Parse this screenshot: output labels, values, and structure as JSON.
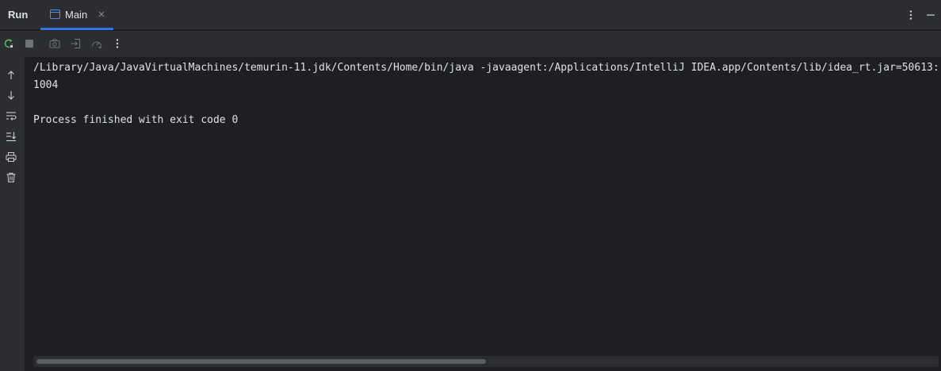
{
  "header": {
    "title": "Run",
    "tab": {
      "label": "Main"
    }
  },
  "icons": {
    "header": [
      "window-icon",
      "close-icon",
      "more-vertical-icon",
      "minimize-icon"
    ],
    "toolbar": [
      "rerun-icon",
      "stop-icon",
      "camera-icon",
      "exit-icon",
      "gauge-icon",
      "more-vertical-icon"
    ],
    "gutter": [
      "arrow-up-icon",
      "arrow-down-icon",
      "soft-wrap-icon",
      "scroll-to-end-icon",
      "print-icon",
      "trash-icon"
    ]
  },
  "console": {
    "lines": [
      "/Library/Java/JavaVirtualMachines/temurin-11.jdk/Contents/Home/bin/java -javaagent:/Applications/IntelliJ IDEA.app/Contents/lib/idea_rt.jar=50613:",
      "1004",
      "",
      "Process finished with exit code 0"
    ]
  },
  "colors": {
    "background": "#1e1f22",
    "panel": "#2b2d30",
    "accent": "#3574f0",
    "text": "#dfe1e5",
    "rerun_green": "#5fb865",
    "icon_gray": "#ced0d6",
    "icon_disabled": "#6f737a"
  },
  "scrollbar": {
    "thumb_fraction": 0.5
  }
}
